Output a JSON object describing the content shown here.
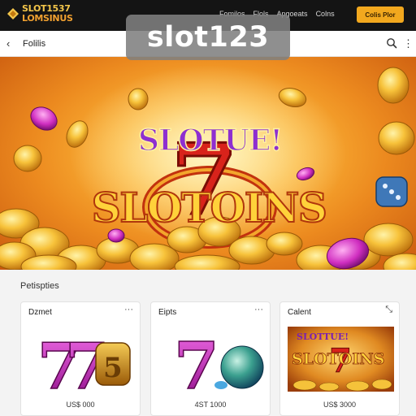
{
  "brand": {
    "line1": "SLOT1537",
    "line2": "LOMSINUS"
  },
  "nav": {
    "links": [
      "Fomilos",
      "Flols",
      "Apgoeats",
      "Colns"
    ],
    "cta": "Colis Plor"
  },
  "subheader": {
    "title": "Folilis"
  },
  "watermark": "slot123",
  "hero": {
    "title_top": "SLOTUE!",
    "seven": "7",
    "title_main": "SLOTOINS"
  },
  "section": {
    "label": "Petispties"
  },
  "cards": [
    {
      "title": "Dzmet",
      "price": "US$ 000"
    },
    {
      "title": "Eipts",
      "price": "4ST 1000"
    },
    {
      "title": "Calent",
      "price": "US$ 3000",
      "art_title_top": "SLOTTUE!",
      "art_title_main": "SLOTOINS"
    }
  ],
  "colors": {
    "nav_bg": "#141414",
    "accent": "#f2a81e",
    "hero_gold": "#fbb437",
    "seven_red": "#d8231b",
    "magenta": "#c026c8"
  },
  "icons": [
    "back-arrow-icon",
    "search-icon",
    "more-vertical-icon",
    "more-horizontal-icon",
    "expand-icon"
  ]
}
